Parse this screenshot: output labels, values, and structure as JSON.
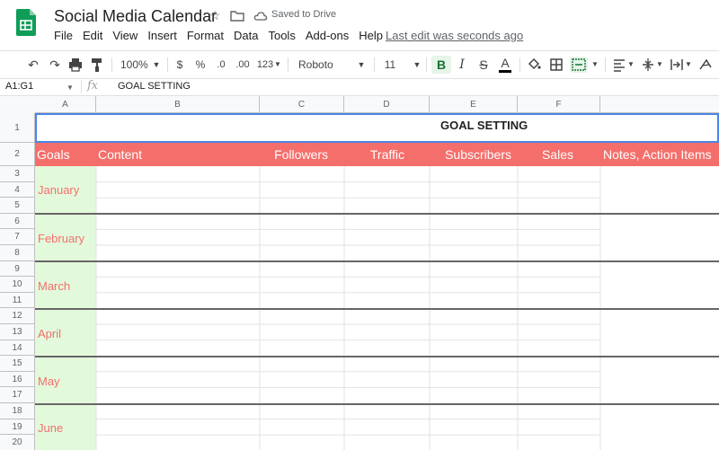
{
  "app": {
    "doc_title": "Social Media Calendar",
    "saved_status": "Saved to Drive",
    "last_edit": "Last edit was seconds ago",
    "menu": [
      "File",
      "Edit",
      "View",
      "Insert",
      "Format",
      "Data",
      "Tools",
      "Add-ons",
      "Help"
    ]
  },
  "toolbar": {
    "zoom": "100%",
    "currency": "$",
    "percent": "%",
    "dec_less": ".0",
    "dec_more": ".00",
    "more_formats": "123",
    "font": "Roboto",
    "font_size": "11",
    "bold": "B",
    "italic": "I",
    "strike": "S",
    "text_color": "A"
  },
  "formula_bar": {
    "name_box": "A1:G1",
    "fx": "fx",
    "content": "GOAL SETTING"
  },
  "columns": [
    "A",
    "B",
    "C",
    "D",
    "E",
    "F"
  ],
  "rows": [
    "1",
    "2",
    "3",
    "4",
    "5",
    "6",
    "7",
    "8",
    "9",
    "10",
    "11",
    "12",
    "13",
    "14",
    "15",
    "16",
    "17",
    "18",
    "19",
    "20"
  ],
  "sheet": {
    "title": "GOAL SETTING",
    "headers": [
      "Goals",
      "Content",
      "Followers",
      "Traffic",
      "Subscribers",
      "Sales",
      "Notes, Action Items"
    ],
    "months": [
      "January",
      "February",
      "March",
      "April",
      "May",
      "June"
    ]
  },
  "colors": {
    "header_bg": "#f46f6b",
    "month_bg": "#e3f9dc",
    "month_text": "#f46f6b",
    "selection": "#4a86e8"
  }
}
